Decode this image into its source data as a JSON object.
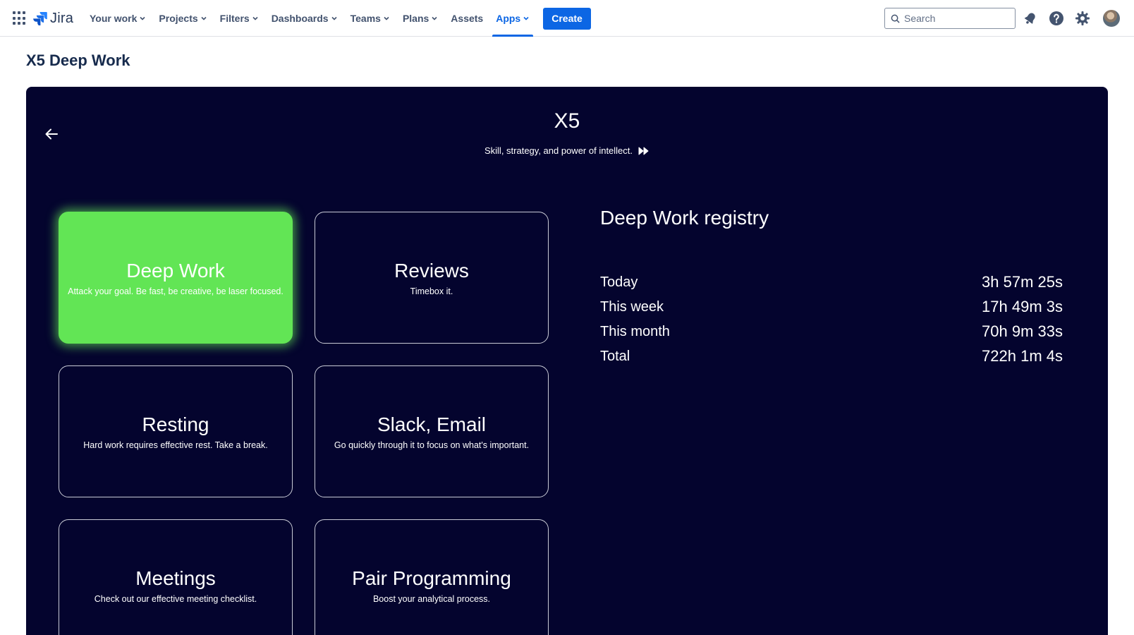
{
  "topnav": {
    "logo_text": "Jira",
    "items": [
      {
        "label": "Your work"
      },
      {
        "label": "Projects"
      },
      {
        "label": "Filters"
      },
      {
        "label": "Dashboards"
      },
      {
        "label": "Teams"
      },
      {
        "label": "Plans"
      },
      {
        "label": "Assets"
      },
      {
        "label": "Apps"
      }
    ],
    "active_item": "Apps",
    "create_label": "Create",
    "search_placeholder": "Search",
    "accent_color": "#0c66e4"
  },
  "page": {
    "title": "X5 Deep Work"
  },
  "hero": {
    "title": "X5",
    "subtitle": "Skill, strategy, and power of intellect."
  },
  "cards": [
    {
      "title": "Deep Work",
      "desc": "Attack your goal. Be fast, be creative, be laser focused.",
      "active": true
    },
    {
      "title": "Reviews",
      "desc": "Timebox it.",
      "active": false
    },
    {
      "title": "Resting",
      "desc": "Hard work requires effective rest. Take a break.",
      "active": false
    },
    {
      "title": "Slack, Email",
      "desc": "Go quickly through it to focus on what's important.",
      "active": false
    },
    {
      "title": "Meetings",
      "desc": "Check out our effective meeting checklist.",
      "active": false
    },
    {
      "title": "Pair Programming",
      "desc": "Boost your analytical process.",
      "active": false
    }
  ],
  "registry": {
    "title": "Deep Work registry",
    "rows": [
      {
        "label": "Today",
        "value": "3h 57m 25s"
      },
      {
        "label": "This week",
        "value": "17h 49m 3s"
      },
      {
        "label": "This month",
        "value": "70h 9m 33s"
      },
      {
        "label": "Total",
        "value": "722h 1m 4s"
      }
    ]
  },
  "colors": {
    "panel_bg": "#04042e",
    "active_card": "#62e555"
  },
  "icons": [
    "app-switcher-icon",
    "jira-logo-icon",
    "chevron-down-icon",
    "search-icon",
    "notification-bell-icon",
    "help-icon",
    "settings-gear-icon",
    "back-arrow-icon",
    "fast-forward-icon"
  ]
}
